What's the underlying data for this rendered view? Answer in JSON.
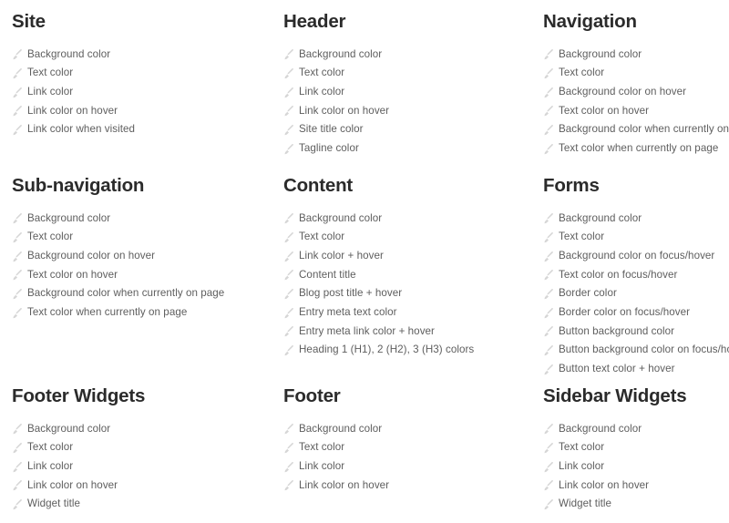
{
  "page": {
    "background_color": "#ffffff",
    "heading_color": "#2b2b2b",
    "label_color": "#5e5e5e",
    "icon_color": "#d6d6d6",
    "icon_name": "paintbrush-icon"
  },
  "sections": [
    {
      "id": "site",
      "title": "Site",
      "options": [
        "Background color",
        "Text color",
        "Link color",
        "Link color on hover",
        "Link color when visited"
      ]
    },
    {
      "id": "header",
      "title": "Header",
      "options": [
        "Background color",
        "Text color",
        "Link color",
        "Link color on hover",
        "Site title color",
        "Tagline color"
      ]
    },
    {
      "id": "navigation",
      "title": "Navigation",
      "options": [
        "Background color",
        "Text color",
        "Background color on hover",
        "Text color on hover",
        "Background color when currently on page",
        "Text color when currently on page"
      ]
    },
    {
      "id": "sub-navigation",
      "title": "Sub-navigation",
      "options": [
        "Background color",
        "Text color",
        "Background color on hover",
        "Text color on hover",
        "Background color when currently on page",
        "Text color when currently on page"
      ]
    },
    {
      "id": "content",
      "title": "Content",
      "options": [
        "Background color",
        "Text color",
        "Link color + hover",
        "Content title",
        "Blog post title + hover",
        "Entry meta text color",
        "Entry meta link color + hover",
        "Heading 1 (H1), 2 (H2), 3 (H3) colors"
      ]
    },
    {
      "id": "forms",
      "title": "Forms",
      "options": [
        "Background color",
        "Text color",
        "Background color on focus/hover",
        "Text color on focus/hover",
        "Border color",
        "Border color on focus/hover",
        "Button background color",
        "Button background color on focus/hover",
        "Button text color + hover"
      ]
    },
    {
      "id": "footer-widgets",
      "title": "Footer Widgets",
      "options": [
        "Background color",
        "Text color",
        "Link color",
        "Link color on hover",
        "Widget title"
      ]
    },
    {
      "id": "footer",
      "title": "Footer",
      "options": [
        "Background color",
        "Text color",
        "Link color",
        "Link color on hover"
      ]
    },
    {
      "id": "sidebar-widgets",
      "title": "Sidebar Widgets",
      "options": [
        "Background color",
        "Text color",
        "Link color",
        "Link color on hover",
        "Widget title"
      ]
    }
  ]
}
